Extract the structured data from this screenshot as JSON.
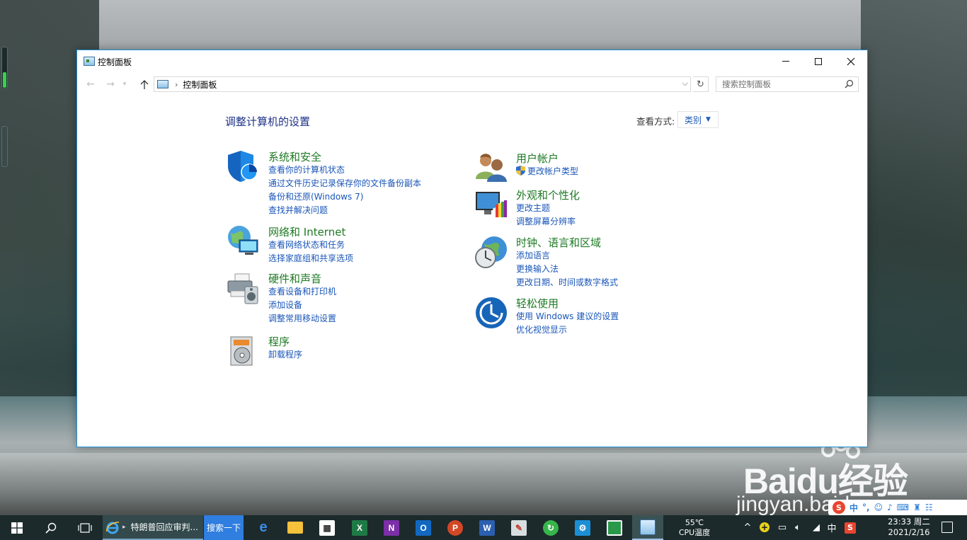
{
  "window": {
    "title": "控制面板",
    "controls": {
      "minimize": "minimize",
      "maximize": "maximize",
      "close": "close"
    }
  },
  "navigation": {
    "address_path": "控制面板",
    "search_placeholder": "搜索控制面板"
  },
  "content": {
    "page_title": "调整计算机的设置",
    "view_by_label": "查看方式:",
    "view_by_value": "类别",
    "categories": [
      {
        "title": "系统和安全",
        "icon": "shield-icon",
        "links": [
          "查看你的计算机状态",
          "通过文件历史记录保存你的文件备份副本",
          "备份和还原(Windows 7)",
          "查找并解决问题"
        ]
      },
      {
        "title": "网络和 Internet",
        "icon": "network-globe-icon",
        "links": [
          "查看网络状态和任务",
          "选择家庭组和共享选项"
        ]
      },
      {
        "title": "硬件和声音",
        "icon": "printer-speaker-icon",
        "links": [
          "查看设备和打印机",
          "添加设备",
          "调整常用移动设置"
        ]
      },
      {
        "title": "程序",
        "icon": "programs-disc-icon",
        "links": [
          "卸载程序"
        ]
      },
      {
        "title": "用户帐户",
        "icon": "users-icon",
        "links": [
          "更改帐户类型"
        ]
      },
      {
        "title": "外观和个性化",
        "icon": "monitor-palette-icon",
        "links": [
          "更改主题",
          "调整屏幕分辨率"
        ]
      },
      {
        "title": "时钟、语言和区域",
        "icon": "clock-globe-icon",
        "links": [
          "添加语言",
          "更换输入法",
          "更改日期、时间或数字格式"
        ]
      },
      {
        "title": "轻松使用",
        "icon": "ease-of-access-icon",
        "links": [
          "使用 Windows 建议的设置",
          "优化视觉显示"
        ]
      }
    ]
  },
  "taskbar": {
    "ie_task_label": "特朗普回应审判...",
    "search_button": "搜索一下",
    "temperature": "55℃",
    "temperature_label": "CPU温度",
    "ime_indicator": "中",
    "time": "23:33 周二",
    "date": "2021/2/16",
    "apps": [
      "edge-icon",
      "file-explorer-icon",
      "store-icon",
      "excel-icon",
      "onenote-icon",
      "outlook-icon",
      "powerpoint-icon",
      "word-icon",
      "paint-icon",
      "refresh-app-icon",
      "settings-icon",
      "project-icon",
      "control-panel-icon"
    ]
  },
  "watermark": {
    "brand": "Baidu经验",
    "sub": "jingyan.baidu.com"
  },
  "colors": {
    "window_border": "#1a8fd6",
    "category_title": "#1e7a24",
    "link": "#1a56b8",
    "page_title": "#1e3287",
    "taskbar": "#1c2a2c"
  }
}
